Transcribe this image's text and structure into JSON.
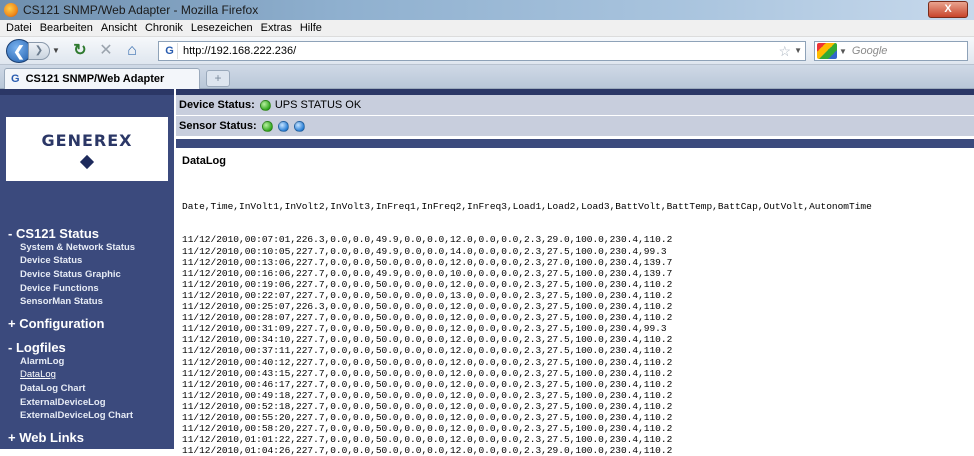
{
  "window": {
    "title": "CS121 SNMP/Web Adapter - Mozilla Firefox",
    "close_label": "X"
  },
  "menu": [
    "Datei",
    "Bearbeiten",
    "Ansicht",
    "Chronik",
    "Lesezeichen",
    "Extras",
    "Hilfe"
  ],
  "nav": {
    "url": "http://192.168.222.236/",
    "search_placeholder": "Google",
    "url_favicon": "G"
  },
  "tab": {
    "label": "CS121 SNMP/Web Adapter",
    "favicon": "G",
    "new_tab": "+"
  },
  "logo": {
    "text": "GENEREX"
  },
  "status": {
    "device_label": "Device Status:",
    "device_text": "UPS STATUS OK",
    "sensor_label": "Sensor Status:",
    "colors": {
      "ok": "#33a81f",
      "sensor": "#2a7fd6"
    }
  },
  "sidebar": {
    "cs121": "- CS121 Status",
    "cs121_items": [
      "System & Network Status",
      "Device Status",
      "Device Status Graphic",
      "Device Functions",
      "SensorMan Status"
    ],
    "configuration": "+ Configuration",
    "logfiles": "- Logfiles",
    "logfile_items": [
      "AlarmLog",
      "DataLog",
      "DataLog Chart",
      "ExternalDeviceLog",
      "ExternalDeviceLog Chart"
    ],
    "weblinks": "+ Web Links"
  },
  "datalog": {
    "title": "DataLog",
    "header": "Date,Time,InVolt1,InVolt2,InVolt3,InFreq1,InFreq2,InFreq3,Load1,Load2,Load3,BattVolt,BattTemp,BattCap,OutVolt,AutonomTime",
    "rows": [
      "11/12/2010,00:07:01,226.3,0.0,0.0,49.9,0.0,0.0,12.0,0.0,0.0,2.3,29.0,100.0,230.4,110.2",
      "11/12/2010,00:10:05,227.7,0.0,0.0,49.9,0.0,0.0,14.0,0.0,0.0,2.3,27.5,100.0,230.4,99.3",
      "11/12/2010,00:13:06,227.7,0.0,0.0,50.0,0.0,0.0,12.0,0.0,0.0,2.3,27.0,100.0,230.4,139.7",
      "11/12/2010,00:16:06,227.7,0.0,0.0,49.9,0.0,0.0,10.0,0.0,0.0,2.3,27.5,100.0,230.4,139.7",
      "11/12/2010,00:19:06,227.7,0.0,0.0,50.0,0.0,0.0,12.0,0.0,0.0,2.3,27.5,100.0,230.4,110.2",
      "11/12/2010,00:22:07,227.7,0.0,0.0,50.0,0.0,0.0,13.0,0.0,0.0,2.3,27.5,100.0,230.4,110.2",
      "11/12/2010,00:25:07,226.3,0.0,0.0,50.0,0.0,0.0,12.0,0.0,0.0,2.3,27.5,100.0,230.4,110.2",
      "11/12/2010,00:28:07,227.7,0.0,0.0,50.0,0.0,0.0,12.0,0.0,0.0,2.3,27.5,100.0,230.4,110.2",
      "11/12/2010,00:31:09,227.7,0.0,0.0,50.0,0.0,0.0,12.0,0.0,0.0,2.3,27.5,100.0,230.4,99.3",
      "11/12/2010,00:34:10,227.7,0.0,0.0,50.0,0.0,0.0,12.0,0.0,0.0,2.3,27.5,100.0,230.4,110.2",
      "11/12/2010,00:37:11,227.7,0.0,0.0,50.0,0.0,0.0,12.0,0.0,0.0,2.3,27.5,100.0,230.4,110.2",
      "11/12/2010,00:40:12,227.7,0.0,0.0,50.0,0.0,0.0,12.0,0.0,0.0,2.3,27.5,100.0,230.4,110.2",
      "11/12/2010,00:43:15,227.7,0.0,0.0,50.0,0.0,0.0,12.0,0.0,0.0,2.3,27.5,100.0,230.4,110.2",
      "11/12/2010,00:46:17,227.7,0.0,0.0,50.0,0.0,0.0,12.0,0.0,0.0,2.3,27.5,100.0,230.4,110.2",
      "11/12/2010,00:49:18,227.7,0.0,0.0,50.0,0.0,0.0,12.0,0.0,0.0,2.3,27.5,100.0,230.4,110.2",
      "11/12/2010,00:52:18,227.7,0.0,0.0,50.0,0.0,0.0,12.0,0.0,0.0,2.3,27.5,100.0,230.4,110.2",
      "11/12/2010,00:55:20,227.7,0.0,0.0,50.0,0.0,0.0,12.0,0.0,0.0,2.3,27.5,100.0,230.4,110.2",
      "11/12/2010,00:58:20,227.7,0.0,0.0,50.0,0.0,0.0,12.0,0.0,0.0,2.3,27.5,100.0,230.4,110.2",
      "11/12/2010,01:01:22,227.7,0.0,0.0,50.0,0.0,0.0,12.0,0.0,0.0,2.3,27.5,100.0,230.4,110.2",
      "11/12/2010,01:04:26,227.7,0.0,0.0,50.0,0.0,0.0,12.0,0.0,0.0,2.3,29.0,100.0,230.4,110.2"
    ]
  }
}
